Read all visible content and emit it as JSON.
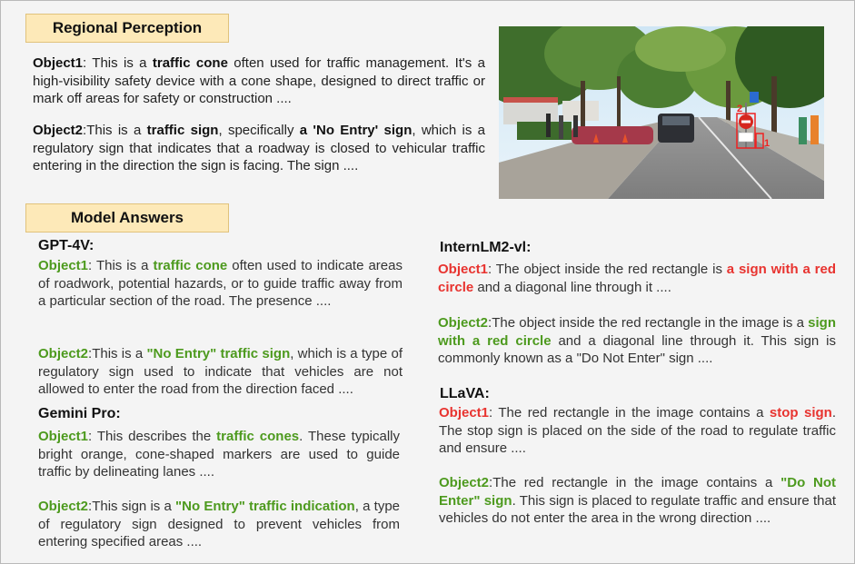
{
  "regional": {
    "label": "Regional Perception",
    "obj1": {
      "name": "Object1",
      "pre": ": This is a ",
      "hl": "traffic cone",
      "post": " often used for traffic management. It's a high-visibility safety device with a cone shape, designed to direct traffic or mark off areas for safety or construction ...."
    },
    "obj2": {
      "name": "Object2",
      "pre": ":This is a ",
      "hl1": "traffic sign",
      "mid": ", specifically ",
      "hl2": "a 'No Entry' sign",
      "post": ", which is a regulatory sign that indicates that a roadway is closed to vehicular traffic entering in the direction the sign is facing. The sign ...."
    }
  },
  "answers_label": "Model Answers",
  "gpt4v": {
    "name": "GPT-4V:",
    "obj1_label": "Object1",
    "obj1_pre": ": This is a ",
    "obj1_hl": "traffic cone",
    "obj1_post": " often used to indicate areas of roadwork, potential hazards, or to guide traffic away from a particular section of the road. The presence ....",
    "obj2_label": "Object2",
    "obj2_pre": ":This is a ",
    "obj2_hl": "\"No Entry\" traffic sign",
    "obj2_post": ", which is a type of regulatory sign used to indicate that vehicles are not allowed to enter the road from the direction faced ...."
  },
  "gemini": {
    "name": "Gemini Pro:",
    "obj1_label": "Object1",
    "obj1_pre": ": This describes the ",
    "obj1_hl": "traffic cones",
    "obj1_post": ". These typically bright orange, cone-shaped markers are used to guide traffic by delineating lanes ....",
    "obj2_label": "Object2",
    "obj2_pre": ":This sign is a ",
    "obj2_hl": "\"No Entry\" traffic indication",
    "obj2_post": ", a type of regulatory sign designed to prevent vehicles from entering specified areas ...."
  },
  "internlm": {
    "name": "InternLM2-vl:",
    "obj1_label": "Object1",
    "obj1_pre": ": The object inside the red rectangle is ",
    "obj1_hl": "a sign with a red circle",
    "obj1_post": " and a diagonal line through it ....",
    "obj2_label": "Object2",
    "obj2_pre": ":The object inside the red rectangle in the image is a ",
    "obj2_hl": "sign with a red circle",
    "obj2_post": " and a diagonal line through it. This sign is commonly known as a \"Do Not Enter\" sign ...."
  },
  "llava": {
    "name": "LLaVA:",
    "obj1_label": "Object1",
    "obj1_pre": ": The red rectangle in the image contains a ",
    "obj1_hl": "stop sign",
    "obj1_post": ". The stop sign is placed on the side of the road to regulate traffic and ensure ....",
    "obj2_label": "Object2",
    "obj2_pre": ":The red rectangle in the image contains a ",
    "obj2_hl": "\"Do Not Enter\" sign",
    "obj2_post": ". This sign is placed to regulate traffic and ensure that vehicles do not enter the area in the wrong direction ...."
  },
  "photo": {
    "marker1": "1",
    "marker2": "2"
  },
  "colors": {
    "correct": "#4d9a1e",
    "wrong": "#e8332f",
    "tag_bg": "#fde9b8"
  }
}
